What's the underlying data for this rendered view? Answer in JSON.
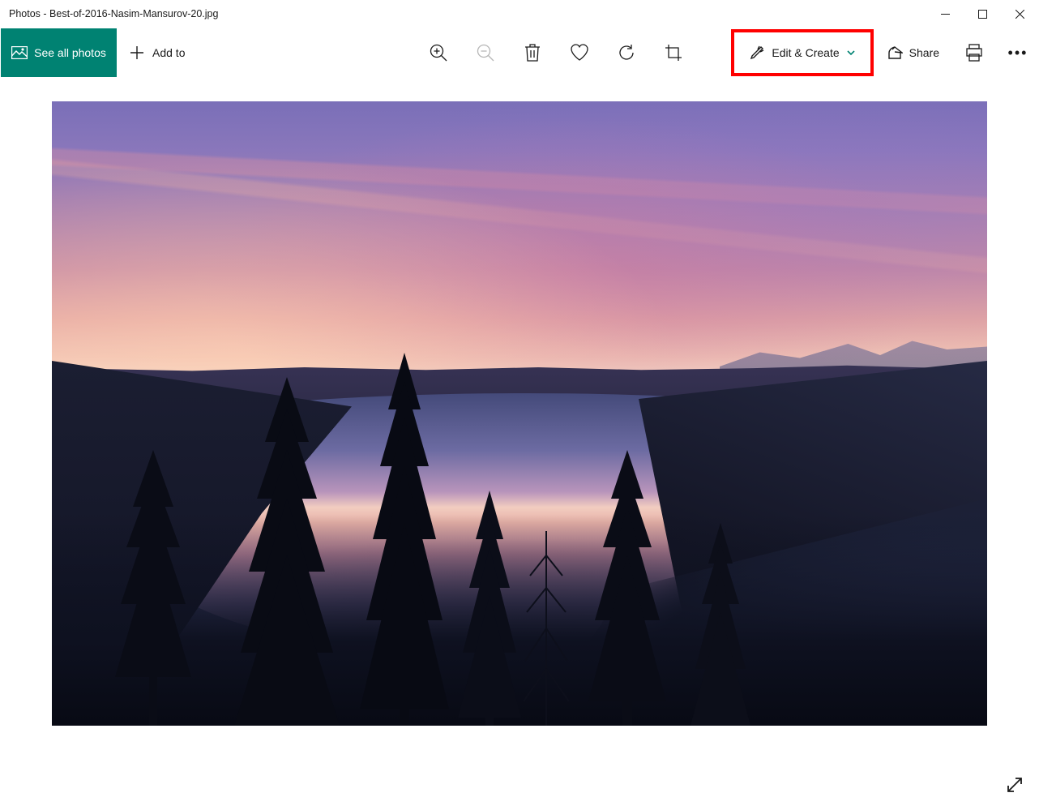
{
  "titlebar": {
    "title": "Photos - Best-of-2016-Nasim-Mansurov-20.jpg"
  },
  "toolbar": {
    "see_all_label": "See all photos",
    "add_to_label": "Add to",
    "edit_create_label": "Edit & Create",
    "share_label": "Share"
  }
}
